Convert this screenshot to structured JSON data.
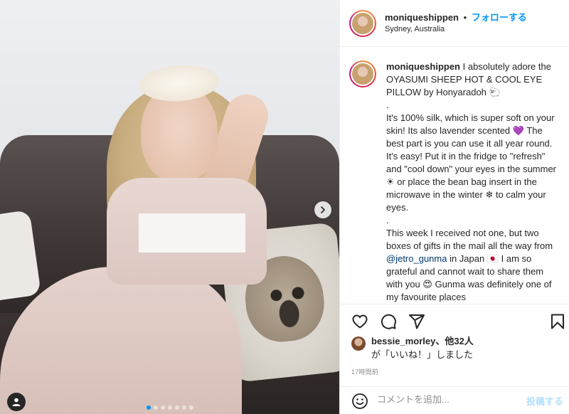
{
  "post": {
    "image_alt": "",
    "carousel": {
      "total": 7,
      "active": 0
    }
  },
  "header": {
    "username": "moniqueshippen",
    "separator": "•",
    "follow_label": "フォローする",
    "location": "Sydney, Australia"
  },
  "caption": {
    "username": "moniqueshippen",
    "text_part1": " I absolutely adore the OYASUMI SHEEP HOT & COOL EYE PILLOW by Honyaradoh 🐑\n.\nIt's 100% silk, which is super soft on your skin! Its also lavender scented 💜 The best part is you can use it all year round. It's easy! Put it in the fridge to \"refresh\" and \"cool down\" your eyes in the summer ☀ or place the bean bag insert in the microwave in the winter ❄ to calm your eyes.\n.\nThis week I received not one, but two boxes of gifts in the mail all the way from ",
    "mention": "@jetro_gunma",
    "text_part2": " in Japan 🇯🇵 I am so grateful and cannot wait to share them with you 😍 Gunma was definitely one of my favourite places"
  },
  "likes": {
    "user": "bessie_morley",
    "others": "、他32人",
    "suffix": "が「いいね！」しました"
  },
  "time_ago": "17時間前",
  "comment": {
    "placeholder": "コメントを追加...",
    "post_label": "投稿する"
  },
  "colors": {
    "accent": "#0095f6",
    "mention": "#00376b",
    "post_disabled": "#b2dffc",
    "muted": "#8e8e8e"
  },
  "icons": {
    "heart": "heart-icon",
    "comment": "comment-icon",
    "share": "paper-plane-icon",
    "save": "bookmark-icon",
    "emoji": "smile-icon",
    "next": "chevron-right-icon",
    "tag": "user-tag-icon"
  }
}
